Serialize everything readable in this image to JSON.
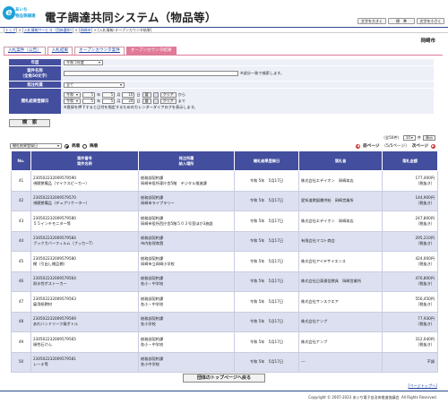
{
  "header": {
    "logo_aichi": "あいち",
    "logo_sub": "物品等調達",
    "title": "電子調達共同システム（物品等）",
    "btn_font_large": "文字を大きく",
    "btn_font_std": "標　準",
    "btn_font_small": "文字を小さく"
  },
  "breadcrumb": {
    "top": "トップ",
    "sep": " > ",
    "item1": "入札情報サービス（団体選択）",
    "item2": "岡崎市",
    "current": "入札情報-オープンカウンタ結果"
  },
  "org_name": "岡崎市",
  "tabs": [
    {
      "label": "入札案件（公告）"
    },
    {
      "label": "入札結果"
    },
    {
      "label": "オープンカウンタ案件"
    },
    {
      "label": "オープンカウンタ結果"
    }
  ],
  "form": {
    "year_label": "年度",
    "year_value": "令和 5年度",
    "name_label": "案件名称",
    "name_sub": "（全角50文字）",
    "name_value": "",
    "name_hint": "※部分一致で検索します。",
    "dept_label": "発注所属",
    "dept_value": "全て",
    "date_label": "開札結果登録日",
    "from": {
      "era": "令和",
      "y": "5",
      "m": "5",
      "d": "10",
      "cal": "暦",
      "clear": "クリア",
      "suffix": "から"
    },
    "to": {
      "era": "令和",
      "y": "5",
      "m": "5",
      "d": "24",
      "cal": "暦",
      "clear": "クリア",
      "suffix": "まで"
    },
    "y_unit": "年",
    "m_unit": "月",
    "d_unit": "日",
    "date_hint": "※直接を押下すると日付を指定するためのカレンダーダイアログを表示します。",
    "search_button": "検　索"
  },
  "sort": {
    "field": "開札結果登録日",
    "asc": "昇順",
    "desc": "降順"
  },
  "pager": {
    "total": "（全50件）",
    "per_page": "10",
    "per_page_unit": "件",
    "go": "表示",
    "prev": "前ページ",
    "page_info": "（5/5ページ）",
    "next": "次ページ"
  },
  "table": {
    "headers": {
      "no": "No.",
      "case": [
        "案件番号",
        "案件名称"
      ],
      "dept": [
        "発注所属",
        "納入場所"
      ],
      "date": "開札結果登録日",
      "winner": "落札者",
      "amount": "落札金額"
    },
    "rows": [
      {
        "no": "41",
        "id": "230502232009579590",
        "name": "視聴覚備品（マイクスピーカー）",
        "dept": "総務部契約課",
        "place": "岡崎市役所東庁舎5階　デジタル推進課",
        "date": "令和 5年　5月17日",
        "winner": "株式会社エデイオン　岡崎本店",
        "amount": "177,400円",
        "tax": "（税抜き）"
      },
      {
        "no": "42",
        "id": "230502232009579570",
        "name": "視聴覚備品（デュプリケーター）",
        "dept": "総務部契約課",
        "place": "岡崎市ライブラリー",
        "date": "令和 5年　5月17日",
        "winner": "愛知道教図書供給　岡崎営業所",
        "amount": "144,900円",
        "tax": "（税抜き）"
      },
      {
        "no": "43",
        "id": "230502232009579580",
        "name": "５５インチモニター等",
        "dept": "総務部契約課",
        "place": "岡崎市役所西庁舎5階５０３号室ほか3施設",
        "date": "令和 5年　5月17日",
        "winner": "株式会社エデイオン　岡崎本店",
        "amount": "247,800円",
        "tax": "（税抜き）"
      },
      {
        "no": "44",
        "id": "230502232009579584",
        "name": "ブックカバーフィルム（ブッカーT）",
        "dept": "総務部契約課",
        "place": "市内各保育園",
        "date": "令和 5年　5月17日",
        "winner": "有限会社マコト商会",
        "amount": "295,210円",
        "tax": "（税抜き）"
      },
      {
        "no": "45",
        "id": "230502232009579580",
        "name": "棚（引出し棚品棚）",
        "dept": "総務部契約課",
        "place": "岡崎市立岡崎小学校",
        "date": "令和 5年　5月17日",
        "winner": "株式会社アイテサイエンス",
        "amount": "424,000円",
        "tax": "（税抜き）"
      },
      {
        "no": "46",
        "id": "230502232009579564",
        "name": "耐水性ボストーカー",
        "dept": "総務部契約課",
        "place": "各小・中学校",
        "date": "令和 5年　5月17日",
        "winner": "株式会社日東通信教具　岡崎営業所",
        "amount": "476,800円",
        "tax": "（税抜き）"
      },
      {
        "no": "47",
        "id": "230502232009579563",
        "name": "雇用紙教材",
        "dept": "総務部契約課",
        "place": "各小・中学校",
        "date": "令和 5年　5月17日",
        "winner": "株式会社サンスクエア",
        "amount": "556,450円",
        "tax": "（税抜き）"
      },
      {
        "no": "48",
        "id": "230502232009579569",
        "name": "あれハンドリーフ風ポトル",
        "dept": "総務部契約課",
        "place": "各小学校",
        "date": "令和 5年　5月17日",
        "winner": "株式会社ナンプ",
        "amount": "77,930円",
        "tax": "（税抜き）"
      },
      {
        "no": "49",
        "id": "230502232009579565",
        "name": "頒性石けん",
        "dept": "総務部契約課",
        "place": "各小・中学校",
        "date": "令和 5年　5月17日",
        "winner": "株式会社ナンプ",
        "amount": "312,040円",
        "tax": "（税抜き）"
      },
      {
        "no": "50",
        "id": "230502232009579581",
        "name": "レーキ等",
        "dept": "総務部契約課",
        "place": "各小中学校",
        "date": "令和 5年　5月17日",
        "winner": "---",
        "amount": "不調",
        "tax": ""
      }
    ]
  },
  "back_button": "団体のトップページへ戻る",
  "page_top": "ページトップへ",
  "footer": "Copyright © 2007-2023 あいち電子自治体推進協議会. All Rights Reserved.",
  "colors": {
    "header_navy": "#434e9e",
    "tab_pink": "#e07a98",
    "row_stripe": "#dde0f1",
    "logo_blue": "#1aa0d8"
  }
}
